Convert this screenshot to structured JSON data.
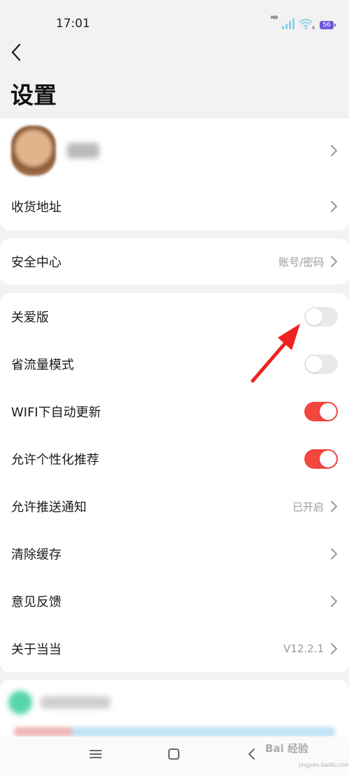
{
  "status_bar": {
    "time": "17:01",
    "hd": "HD",
    "wifi_sub": "6",
    "battery": "56"
  },
  "header": {
    "title": "设置"
  },
  "profile": {
    "address_label": "收货地址"
  },
  "security": {
    "label": "安全中心",
    "value": "账号/密码"
  },
  "settings": {
    "care_mode": {
      "label": "关爱版",
      "on": false
    },
    "data_saver": {
      "label": "省流量模式",
      "on": false
    },
    "wifi_update": {
      "label": "WIFI下自动更新",
      "on": true
    },
    "personalized": {
      "label": "允许个性化推荐",
      "on": true
    },
    "push": {
      "label": "允许推送通知",
      "value": "已开启"
    },
    "clear_cache": {
      "label": "清除缓存"
    },
    "feedback": {
      "label": "意见反馈"
    },
    "about": {
      "label": "关于当当",
      "value": "V12.2.1"
    }
  },
  "colors": {
    "toggle_on": "#f2463f",
    "toggle_off": "#e9e9e9",
    "annotation_arrow": "#ee2222"
  },
  "watermark": {
    "text": "Bai 经验",
    "sub": "jingyan.baidu.com"
  }
}
